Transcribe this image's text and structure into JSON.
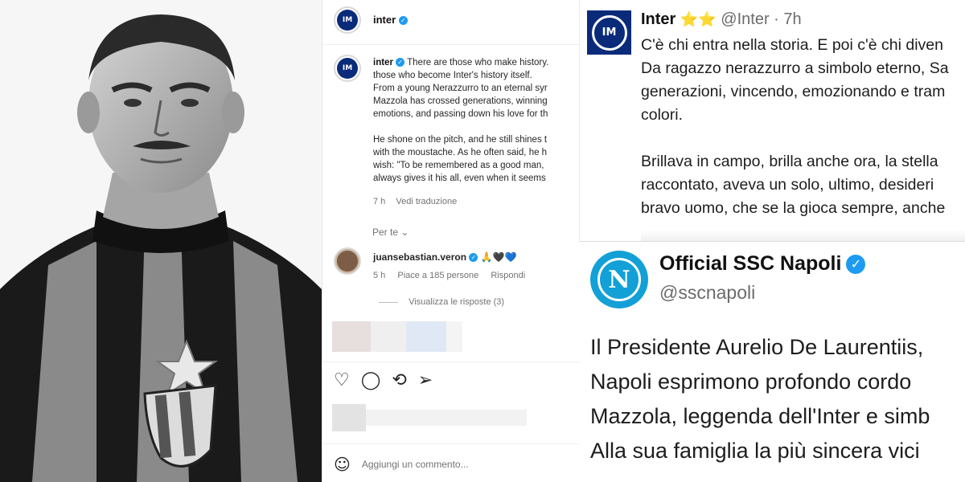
{
  "instagram": {
    "account": "inter",
    "avatar_text": "IM",
    "caption_user": "inter",
    "caption_lines": [
      "There are those who make history.",
      "those who become Inter's history itself.",
      "From a young Nerazzurro to an eternal syr",
      "Mazzola has crossed generations, winning",
      "emotions, and passing down his love for th",
      "",
      "He shone on the pitch, and he still shines t",
      "with the moustache. As he often said, he h",
      "wish: \"To be remembered as a good man,",
      "always gives it his all, even when it seems"
    ],
    "post_time": "7 h",
    "see_translation": "Vedi traduzione",
    "see_also": "Per te",
    "comment": {
      "user": "juansebastian.veron",
      "text": "🙏🖤💙",
      "time": "5 h",
      "likes": "Piace a 185 persone",
      "reply": "Rispondi",
      "view_replies": "Visualizza le risposte (3)"
    },
    "add_comment_placeholder": "Aggiungi un commento..."
  },
  "inter_tweet": {
    "logo_text": "IM",
    "name": "Inter",
    "stars": "⭐⭐",
    "handle": "@Inter · 7h",
    "lines": [
      "C'è chi entra nella storia. E poi c'è chi diven",
      "Da ragazzo nerazzurro a simbolo eterno, Sa",
      "generazioni, vincendo, emozionando e tram",
      "colori.",
      "",
      "Brillava in campo, brilla anche ora, la stella",
      "raccontato, aveva un solo, ultimo, desideri",
      "bravo uomo, che se la gioca sempre, anche"
    ]
  },
  "napoli_tweet": {
    "logo_text": "N",
    "name": "Official SSC Napoli",
    "handle": "@sscnapoli",
    "lines": [
      "Il Presidente Aurelio De Laurentiis,",
      "Napoli esprimono profondo cordo",
      "Mazzola, leggenda dell'Inter e simb",
      "Alla sua famiglia la più sincera vici"
    ]
  },
  "colors": {
    "inter_blue": "#0a2b7a",
    "napoli_blue": "#12a0d7",
    "verified_blue": "#1d9bf0",
    "star_gold": "#f4b400"
  }
}
